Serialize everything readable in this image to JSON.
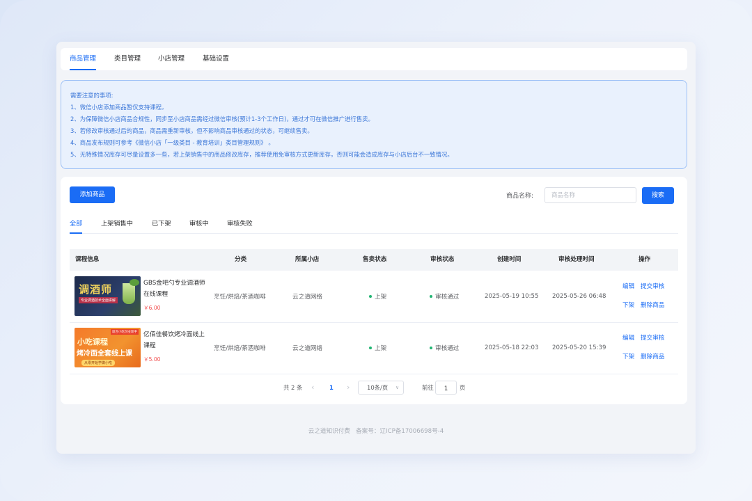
{
  "colors": {
    "primary": "#1a6cf5",
    "success": "#21b573",
    "price": "#f25252",
    "notice_text": "#3c77d8"
  },
  "topnav": {
    "tabs": [
      {
        "label": "商品管理",
        "active": true
      },
      {
        "label": "类目管理",
        "active": false
      },
      {
        "label": "小店管理",
        "active": false
      },
      {
        "label": "基础设置",
        "active": false
      }
    ]
  },
  "notice": {
    "lines": [
      "需要注意的事项:",
      "1、微信小店添加商品暂仅支持课程。",
      "2、为保障微信小店商品合规性，同步至小店商品需经过微信审核(预计1-3个工作日)，通过才可在微信推广进行售卖。",
      "3、若修改审核通过后的商品，商品需重新审核，但不影响商品审核通过的状态，可继续售卖。",
      "4、商品发布规则可参考《微信小店「一级类目 - 教育培训」类目管理规则》 。",
      "5、无特殊情况库存可尽量设置多一些，若上架销售中的商品修改库存，推荐使用免审核方式更新库存，否则可能会造成库存与小店后台不一致情况。"
    ]
  },
  "toolbar": {
    "add_label": "添加商品",
    "search_label": "商品名称:",
    "search_placeholder": "商品名称",
    "search_button": "搜索"
  },
  "subtabs": [
    "全部",
    "上架销售中",
    "已下架",
    "审核中",
    "审核失败"
  ],
  "table": {
    "headers": [
      "课程信息",
      "分类",
      "所属小店",
      "售卖状态",
      "审核状态",
      "创建时间",
      "审核处理时间",
      "操作"
    ],
    "rows": [
      {
        "thumb_title": "调酒师",
        "thumb_sub": "专业调酒技术全面讲解",
        "title": "GBS金吧勺专业调酒师在线课程",
        "price": "￥6.00",
        "category": "烹饪/烘焙/茶酒咖啡",
        "shop": "云之道网络",
        "sale_status": "上架",
        "audit_status": "审核通过",
        "created": "2025-05-19 10:55",
        "audited": "2025-05-26 06:48",
        "ops": [
          "编辑",
          "提交审核",
          "下架",
          "删除商品"
        ]
      },
      {
        "thumb_title": "小吃课程",
        "thumb_title2": "烤冷面全套线上课",
        "thumb_tag": "适合小吃创业新手",
        "thumb_sub": "从零开始学做小吃",
        "title": "亿佰佳餐饮烤冷面线上课程",
        "price": "￥5.00",
        "category": "烹饪/烘焙/茶酒咖啡",
        "shop": "云之道网络",
        "sale_status": "上架",
        "audit_status": "审核通过",
        "created": "2025-05-18 22:03",
        "audited": "2025-05-20 15:39",
        "ops": [
          "编辑",
          "提交审核",
          "下架",
          "删除商品"
        ]
      }
    ]
  },
  "pagination": {
    "total": "共 2 条",
    "current": "1",
    "page_size": "10条/页",
    "goto_label": "前往",
    "goto_value": "1",
    "goto_suffix": "页"
  },
  "footer": "云之道知识付费   备案号：辽ICP备17006698号-4"
}
